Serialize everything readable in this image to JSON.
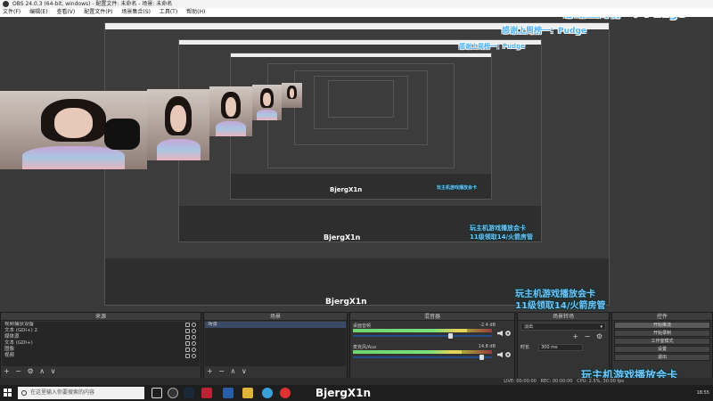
{
  "window": {
    "title": "OBS 24.0.3 (64-bit, windows) - 配置文件: 未命名 - 场景: 未命名"
  },
  "menu": [
    "文件(F)",
    "编辑(E)",
    "查看(V)",
    "配置文件(P)",
    "场景集合(S)",
    "工具(T)",
    "帮助(H)"
  ],
  "overlay": {
    "top_banner": "感谢上周榜一：Pudge",
    "username": "BjergX1n",
    "bottom_line1": "玩主机游戏播放会卡",
    "bottom_line2": "11级领取14/火箭房管"
  },
  "docks": {
    "sources": {
      "title": "来源",
      "items": [
        "视频捕获设备",
        "文本 (GDI+) 2",
        "媒体源",
        "文本 (GDI+)",
        "图像",
        "视频"
      ],
      "toolbar": [
        "+",
        "−",
        "⚙",
        "∧",
        "∨"
      ]
    },
    "scenes": {
      "title": "场景",
      "items": [
        "场景"
      ],
      "toolbar": [
        "+",
        "−",
        "∧",
        "∨"
      ]
    },
    "mixer": {
      "title": "混音器",
      "channels": [
        {
          "name": "桌面音频",
          "value": "-2.4 dB",
          "level": 0.82,
          "volume": 0.7
        },
        {
          "name": "麦克风/Aux",
          "value": "14.8 dB",
          "level": 0.78,
          "volume": 0.92
        }
      ]
    },
    "transitions": {
      "title": "场景转场",
      "selected": "淡出",
      "toolbar": [
        "+",
        "−",
        "⚙"
      ],
      "duration_label": "时长",
      "duration_value": "300 ms"
    },
    "controls": {
      "title": "控件",
      "buttons": [
        "开始推流",
        "开始录制",
        "工作室模式",
        "设置",
        "退出"
      ]
    }
  },
  "statusbar": {
    "live": "LIVE: 00:00:00",
    "rec": "REC: 00:00:00",
    "cpu": "CPU: 2.5%, 30.00 fps"
  },
  "taskbar": {
    "search_placeholder": "在这里输入你要搜索的内容",
    "tray_time": "18:55"
  },
  "colors": {
    "obs_bg": "#2b2b2b",
    "overlay_blue": "#4fb3ff",
    "taskbar": "#1e1e1e"
  }
}
